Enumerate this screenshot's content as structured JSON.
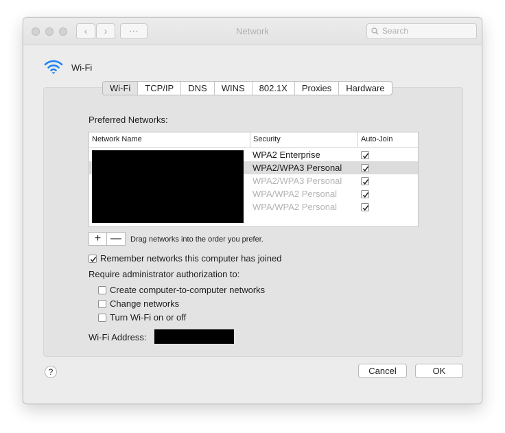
{
  "window": {
    "title": "Network"
  },
  "titlebar": {
    "back_glyph": "‹",
    "forward_glyph": "›",
    "grid_glyph": "⋯",
    "search_placeholder": "Search"
  },
  "interface": {
    "name": "Wi-Fi",
    "icon": "wifi-icon"
  },
  "tabs": [
    {
      "label": "Wi-Fi",
      "active": true
    },
    {
      "label": "TCP/IP"
    },
    {
      "label": "DNS"
    },
    {
      "label": "WINS"
    },
    {
      "label": "802.1X"
    },
    {
      "label": "Proxies"
    },
    {
      "label": "Hardware"
    }
  ],
  "preferred": {
    "label": "Preferred Networks:",
    "columns": [
      "Network Name",
      "Security",
      "Auto-Join"
    ],
    "rows": [
      {
        "security": "WPA2 Enterprise",
        "auto_join": true,
        "dim": false,
        "selected": false
      },
      {
        "security": "WPA2/WPA3 Personal",
        "auto_join": true,
        "dim": false,
        "selected": true
      },
      {
        "security": "WPA2/WPA3 Personal",
        "auto_join": true,
        "dim": true,
        "selected": false
      },
      {
        "security": "WPA/WPA2 Personal",
        "auto_join": true,
        "dim": true,
        "selected": false
      },
      {
        "security": "WPA/WPA2 Personal",
        "auto_join": true,
        "dim": true,
        "selected": false
      }
    ],
    "add_label": "+",
    "remove_label": "—",
    "drag_hint": "Drag networks into the order you prefer."
  },
  "options": {
    "remember": {
      "label": "Remember networks this computer has joined",
      "checked": true
    },
    "require_label": "Require administrator authorization to:",
    "create_networks": {
      "label": "Create computer-to-computer networks",
      "checked": false
    },
    "change_networks": {
      "label": "Change networks",
      "checked": false
    },
    "toggle_wifi": {
      "label": "Turn Wi-Fi on or off",
      "checked": false
    }
  },
  "address": {
    "label": "Wi-Fi Address:"
  },
  "footer": {
    "help": "?",
    "cancel": "Cancel",
    "ok": "OK"
  },
  "colors": {
    "wifi_blue": "#1c83f5",
    "window_bg": "#ececec",
    "panel_bg": "#e3e3e3"
  }
}
